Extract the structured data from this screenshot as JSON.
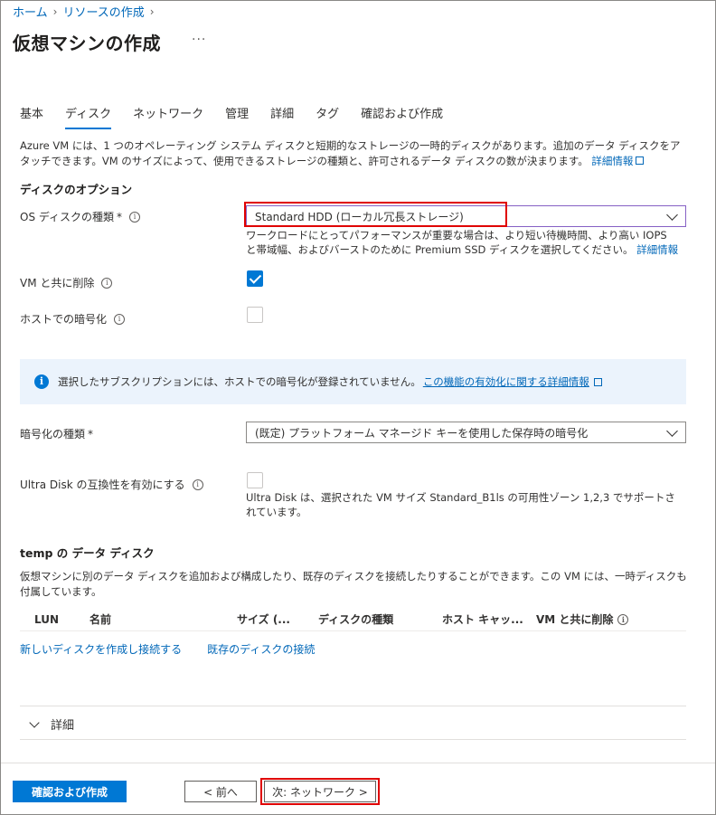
{
  "breadcrumb": {
    "home": "ホーム",
    "create_resource": "リソースの作成"
  },
  "page": {
    "title": "仮想マシンの作成",
    "more": "···"
  },
  "tabs": [
    {
      "label": "基本"
    },
    {
      "label": "ディスク"
    },
    {
      "label": "ネットワーク"
    },
    {
      "label": "管理"
    },
    {
      "label": "詳細"
    },
    {
      "label": "タグ"
    },
    {
      "label": "確認および作成"
    }
  ],
  "active_tab": "ディスク",
  "intro": {
    "text": "Azure VM には、1 つのオペレーティング システム ディスクと短期的なストレージの一時的ディスクがあります。追加のデータ ディスクをアタッチできます。VM のサイズによって、使用できるストレージの種類と、許可されるデータ ディスクの数が決まります。",
    "link": "詳細情報"
  },
  "disk_options": {
    "heading": "ディスクのオプション",
    "os_disk_type_label": "OS ディスクの種類",
    "required_mark": "*",
    "os_disk_type_value": "Standard HDD (ローカル冗長ストレージ)",
    "os_disk_help": "ワークロードにとってパフォーマンスが重要な場合は、より短い待機時間、より高い IOPS と帯域幅、およびバーストのために Premium SSD ディスクを選択してください。",
    "os_disk_help_link": "詳細情報",
    "delete_with_vm_label": "VM と共に削除",
    "delete_with_vm_checked": true,
    "host_encryption_label": "ホストでの暗号化",
    "host_encryption_checked": false
  },
  "infobar": {
    "icon": "info-icon",
    "text": "選択したサブスクリプションには、ホストでの暗号化が登録されていません。",
    "link": "この機能の有効化に関する詳細情報"
  },
  "encryption": {
    "label": "暗号化の種類",
    "required_mark": "*",
    "value": "(既定) プラットフォーム マネージド キーを使用した保存時の暗号化"
  },
  "ultra_disk": {
    "label": "Ultra Disk の互換性を有効にする",
    "checked": false,
    "help": "Ultra Disk は、選択された VM サイズ Standard_B1ls の可用性ゾーン 1,2,3 でサポートされています。"
  },
  "data_disks": {
    "heading": "temp の データ ディスク",
    "description": "仮想マシンに別のデータ ディスクを追加および構成したり、既存のディスクを接続したりすることができます。この VM には、一時ディスクも付属しています。",
    "columns": [
      "LUN",
      "名前",
      "サイズ (...",
      "ディスクの種類",
      "ホスト キャッ...",
      "VM と共に削除"
    ],
    "create_link": "新しいディスクを作成し接続する",
    "attach_link": "既存のディスクの接続"
  },
  "details_label": "詳細",
  "footer": {
    "review_create": "確認および作成",
    "prev": "< 前へ",
    "next": "次: ネットワーク >"
  },
  "colors": {
    "accent": "#0078d4",
    "link": "#0067b8",
    "highlight": "#e00000",
    "infobar_bg": "#ebf3fc"
  }
}
